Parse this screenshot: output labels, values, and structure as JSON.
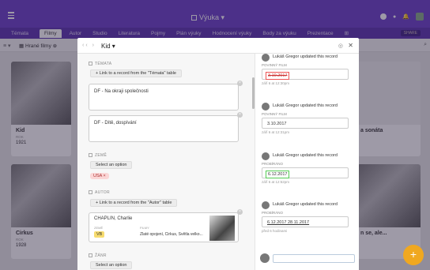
{
  "app": {
    "title": "Výuka"
  },
  "tabs": [
    "Témata",
    "Filmy",
    "Autor",
    "Studio",
    "Literatura",
    "Pojmy",
    "Plán výuky",
    "Hodnocení výuky",
    "Body za výuku",
    "Prezentace"
  ],
  "active_tab_index": 1,
  "share_label": "SHARE",
  "view": {
    "label": "Hrané filmy"
  },
  "gallery": {
    "cards": [
      {
        "name": "Kid",
        "field_label": "ROK",
        "value": "1921"
      },
      {
        "name": "Cirkus",
        "field_label": "ROK",
        "value": "1928"
      },
      {
        "name": "a sonáta",
        "field_label": "",
        "value": ""
      },
      {
        "name": "n se, ale...",
        "field_label": "",
        "value": ""
      }
    ]
  },
  "modal": {
    "title": "Kid",
    "fields": {
      "temata_label": "TÉMATA",
      "temata_link_btn": "+ Link to a record from the \"Témata\" table",
      "temata_items": [
        "DF - Na okraji společnosti",
        "DF - Dítě, dospívání"
      ],
      "zeme_label": "ZEMĚ",
      "zeme_select": "Select an option",
      "zeme_tag": "USA",
      "autor_label": "AUTOR",
      "autor_link_btn": "+ Link to a record from the \"Autor\" table",
      "autor_card": {
        "name": "CHAPLIN, Charlie",
        "zeme_label": "ZEMĚ",
        "zeme_value": "VB",
        "filmy_label": "FILMY",
        "filmy_value": "Zlaté opojení, Cirkus, Světla velko..."
      },
      "zanr_label": "ŽÁNR",
      "zanr_select": "Select an option"
    },
    "activity": [
      {
        "who": "Lukáš Gregor updated this record",
        "field": "",
        "value_old": "3.10.2017",
        "value_new": "",
        "when": ""
      },
      {
        "who": "Lukáš Gregor updated this record",
        "field": "POVINNÝ FILM",
        "value_old": "",
        "value_new": "3.10.2017",
        "when": "září 6 at 12:31pm"
      },
      {
        "who": "Lukáš Gregor updated this record",
        "field": "PROBÍRÁNO",
        "value_old": "",
        "value_new": "6.12.2017",
        "when": "září 6 at 12:52pm"
      },
      {
        "who": "Lukáš Gregor updated this record",
        "field": "PROBÍRÁNO",
        "value_old": "",
        "value_new": "6.12.2017  28.11.2017",
        "when": "před 6 hodinami"
      }
    ],
    "activity_top_when": "září 6 at 12:30pm",
    "activity_top_field": "POVINNÝ FILM"
  },
  "colors": {
    "topbar": "#6b3fc9",
    "accent": "#f0a820"
  },
  "icons": [
    "apps-icon",
    "grid-icon",
    "help-icon",
    "bell-icon",
    "search-icon",
    "rss-icon",
    "close-icon",
    "plus-icon"
  ]
}
